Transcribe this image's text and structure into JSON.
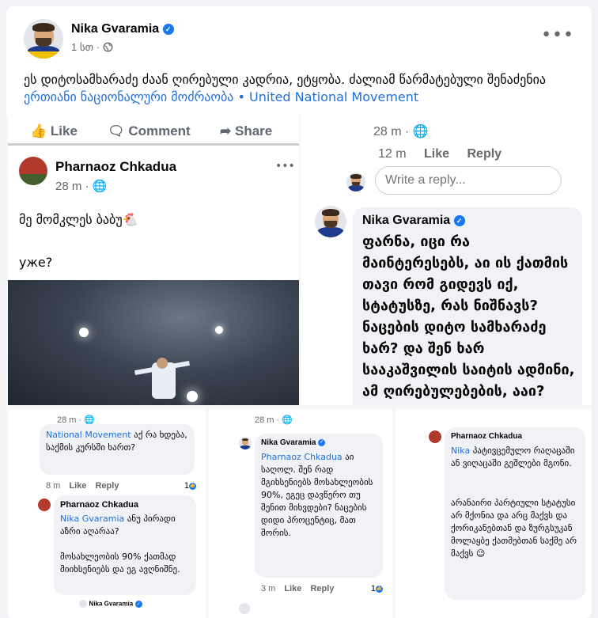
{
  "post": {
    "author": "Nika Gvaramia",
    "time": "1 სთ ·",
    "text_main": "ეს დიტოსამხარაძე ძაან ღირებული კადრია, ეტყობა. ძალიამ წარმატებული შენაძენია ",
    "text_link": "ერთიანი ნაციონალური მოძრაობა • United National Movement",
    "more": "•••"
  },
  "colors": {
    "link": "#216fdb",
    "accent": "#1877f2",
    "bubble": "#f0f2f5"
  },
  "p1": {
    "like": "Like",
    "comment": "Comment",
    "share": "Share",
    "author": "Pharnaoz Chkadua",
    "time": "28 m ·",
    "line1": "მე მომკლეს ბაბუ🐔",
    "line2": "уже?",
    "more": "•••"
  },
  "p2": {
    "time": "28 m ·",
    "reply_meta": "12 m",
    "like": "Like",
    "reply": "Reply",
    "write_placeholder": "Write a reply...",
    "author": "Nika Gvaramia",
    "text": "ფარნა, იცი რა მაინტერესებს, აი ის ქათმის თავი რომ გიდევს იქ, სტატუსზე, რას ნიშნავს? ნაცების დიტო სამხარაძე ხარ? და შენ ხარ სააკაშვილის საიტის ადმინი, ამ ღირებულებების, ააი?"
  },
  "p3": {
    "time": "28 m ·",
    "link_text": "National Movement",
    "text1": " აქ რა ხდება, საქმის კურსში ხართ?",
    "age": "8 m",
    "like": "Like",
    "reply": "Reply",
    "count": "1",
    "author2": "Pharnaoz Chkadua",
    "mention": "Nika Gvaramia",
    "text2": " ანუ პირადი აზრი აღარაა?",
    "text3": "მოსახლეობის 90% ქათმად მიიხსენიებს და ეგ ავღნიშნე.",
    "author3": "Nika Gvaramia"
  },
  "p4": {
    "time": "28 m ·",
    "author": "Nika Gvaramia",
    "mention": "Pharnaoz Chkadua",
    "text": " აი საღოლ. შენ რად მგიხსენიებს მოსახლეობის 90%, ეგეც დავწერო თუ შენით მიხვდები? ნაცების დიდი პროცენტიც, მათ შორის.",
    "age": "3 m",
    "like": "Like",
    "reply": "Reply",
    "count": "1"
  },
  "p5": {
    "author": "Pharnaoz Chkadua",
    "mention": "Nika",
    "text1": " პატივცემულო რაღაცაში ან ვიღაცაში გეშლები მგონი.",
    "text2": "არანაირი პარტიული სტატუსი არ მქონია და არც მაქვს და ქორიკანებთან და ზურგსუკან მოლაყბე ქათმებთან საქმე არ მაქვს 😉"
  }
}
